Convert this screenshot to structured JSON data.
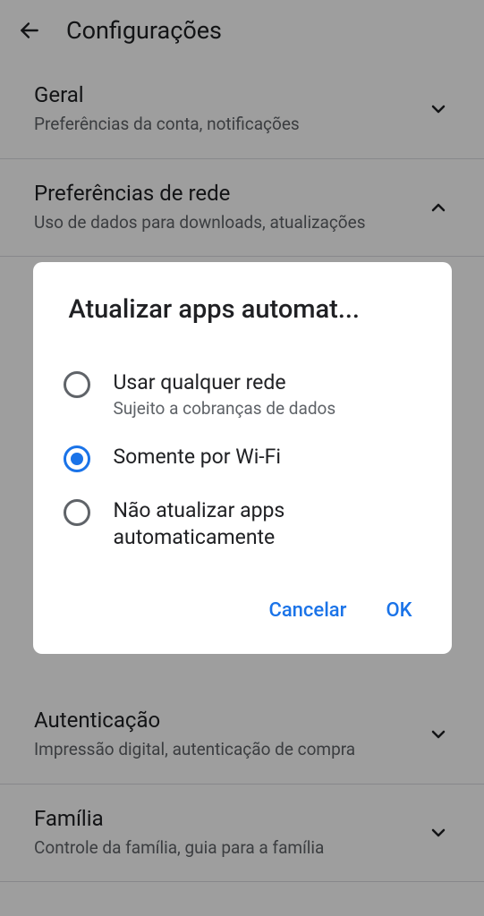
{
  "header": {
    "title": "Configurações"
  },
  "sections": {
    "general": {
      "title": "Geral",
      "subtitle": "Preferências da conta, notificações"
    },
    "network": {
      "title": "Preferências de rede",
      "subtitle": "Uso de dados para downloads, atualizações"
    },
    "auth": {
      "title": "Autenticação",
      "subtitle": "Impressão digital, autenticação de compra"
    },
    "family": {
      "title": "Família",
      "subtitle": "Controle da família, guia para a família"
    }
  },
  "dialog": {
    "title": "Atualizar apps automat...",
    "options": {
      "any": {
        "label": "Usar qualquer rede",
        "sublabel": "Sujeito a cobranças de dados"
      },
      "wifi": {
        "label": "Somente por Wi-Fi"
      },
      "none": {
        "label": "Não atualizar apps automaticamente"
      }
    },
    "cancel": "Cancelar",
    "ok": "OK"
  }
}
